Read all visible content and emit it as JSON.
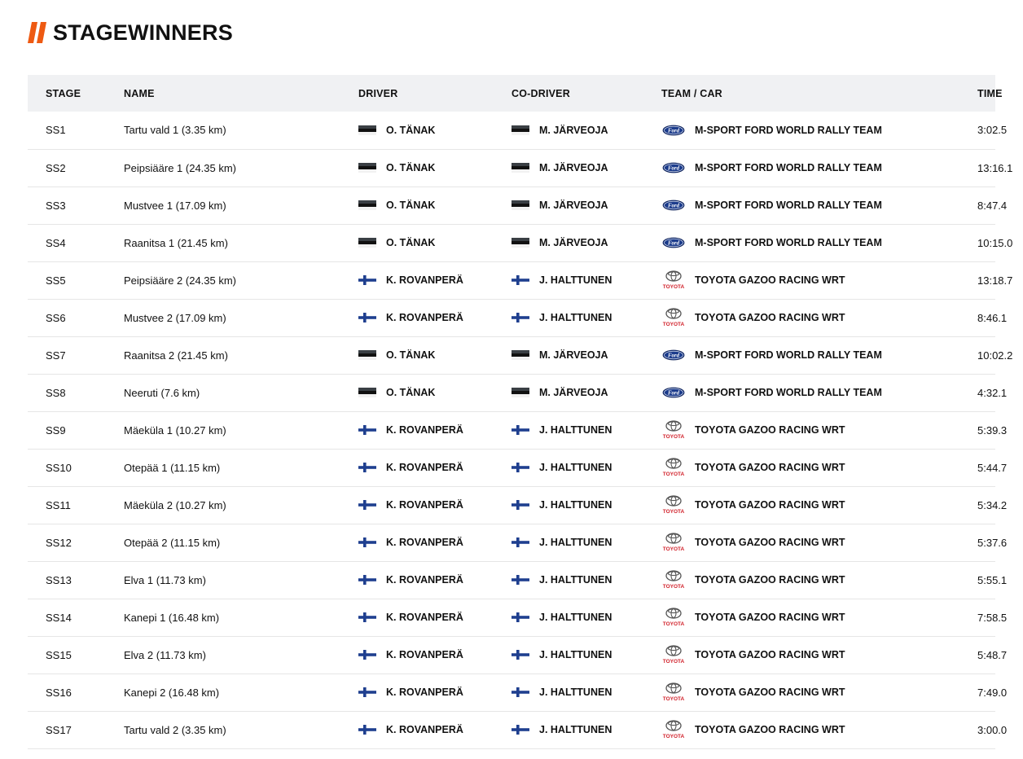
{
  "page": {
    "title": "STAGEWINNERS",
    "accent_color": "#ee5a12"
  },
  "table": {
    "headers": {
      "stage": "STAGE",
      "name": "NAME",
      "driver": "DRIVER",
      "co_driver": "CO-DRIVER",
      "team_car": "TEAM / CAR",
      "time": "TIME"
    },
    "rows": [
      {
        "stage": "SS1",
        "name": "Tartu vald 1 (3.35 km)",
        "driver": "O. TÄNAK",
        "driver_flag": "estonia-flag-icon",
        "co_driver": "M. JÄRVEOJA",
        "co_driver_flag": "estonia-flag-icon",
        "team": "M-SPORT FORD WORLD RALLY TEAM",
        "team_logo": "ford-logo-icon",
        "time": "3:02.5"
      },
      {
        "stage": "SS2",
        "name": "Peipsiääre 1 (24.35 km)",
        "driver": "O. TÄNAK",
        "driver_flag": "estonia-flag-icon",
        "co_driver": "M. JÄRVEOJA",
        "co_driver_flag": "estonia-flag-icon",
        "team": "M-SPORT FORD WORLD RALLY TEAM",
        "team_logo": "ford-logo-icon",
        "time": "13:16.1"
      },
      {
        "stage": "SS3",
        "name": "Mustvee 1 (17.09 km)",
        "driver": "O. TÄNAK",
        "driver_flag": "estonia-flag-icon",
        "co_driver": "M. JÄRVEOJA",
        "co_driver_flag": "estonia-flag-icon",
        "team": "M-SPORT FORD WORLD RALLY TEAM",
        "team_logo": "ford-logo-icon",
        "time": "8:47.4"
      },
      {
        "stage": "SS4",
        "name": "Raanitsa 1 (21.45 km)",
        "driver": "O. TÄNAK",
        "driver_flag": "estonia-flag-icon",
        "co_driver": "M. JÄRVEOJA",
        "co_driver_flag": "estonia-flag-icon",
        "team": "M-SPORT FORD WORLD RALLY TEAM",
        "team_logo": "ford-logo-icon",
        "time": "10:15.0"
      },
      {
        "stage": "SS5",
        "name": "Peipsiääre 2 (24.35 km)",
        "driver": "K. ROVANPERÄ",
        "driver_flag": "finland-flag-icon",
        "co_driver": "J. HALTTUNEN",
        "co_driver_flag": "finland-flag-icon",
        "team": "TOYOTA GAZOO RACING WRT",
        "team_logo": "toyota-logo-icon",
        "time": "13:18.7"
      },
      {
        "stage": "SS6",
        "name": "Mustvee 2 (17.09 km)",
        "driver": "K. ROVANPERÄ",
        "driver_flag": "finland-flag-icon",
        "co_driver": "J. HALTTUNEN",
        "co_driver_flag": "finland-flag-icon",
        "team": "TOYOTA GAZOO RACING WRT",
        "team_logo": "toyota-logo-icon",
        "time": "8:46.1"
      },
      {
        "stage": "SS7",
        "name": "Raanitsa 2 (21.45 km)",
        "driver": "O. TÄNAK",
        "driver_flag": "estonia-flag-icon",
        "co_driver": "M. JÄRVEOJA",
        "co_driver_flag": "estonia-flag-icon",
        "team": "M-SPORT FORD WORLD RALLY TEAM",
        "team_logo": "ford-logo-icon",
        "time": "10:02.2"
      },
      {
        "stage": "SS8",
        "name": "Neeruti (7.6 km)",
        "driver": "O. TÄNAK",
        "driver_flag": "estonia-flag-icon",
        "co_driver": "M. JÄRVEOJA",
        "co_driver_flag": "estonia-flag-icon",
        "team": "M-SPORT FORD WORLD RALLY TEAM",
        "team_logo": "ford-logo-icon",
        "time": "4:32.1"
      },
      {
        "stage": "SS9",
        "name": "Mäeküla 1 (10.27 km)",
        "driver": "K. ROVANPERÄ",
        "driver_flag": "finland-flag-icon",
        "co_driver": "J. HALTTUNEN",
        "co_driver_flag": "finland-flag-icon",
        "team": "TOYOTA GAZOO RACING WRT",
        "team_logo": "toyota-logo-icon",
        "time": "5:39.3"
      },
      {
        "stage": "SS10",
        "name": "Otepää 1 (11.15 km)",
        "driver": "K. ROVANPERÄ",
        "driver_flag": "finland-flag-icon",
        "co_driver": "J. HALTTUNEN",
        "co_driver_flag": "finland-flag-icon",
        "team": "TOYOTA GAZOO RACING WRT",
        "team_logo": "toyota-logo-icon",
        "time": "5:44.7"
      },
      {
        "stage": "SS11",
        "name": "Mäeküla 2 (10.27 km)",
        "driver": "K. ROVANPERÄ",
        "driver_flag": "finland-flag-icon",
        "co_driver": "J. HALTTUNEN",
        "co_driver_flag": "finland-flag-icon",
        "team": "TOYOTA GAZOO RACING WRT",
        "team_logo": "toyota-logo-icon",
        "time": "5:34.2"
      },
      {
        "stage": "SS12",
        "name": "Otepää 2 (11.15 km)",
        "driver": "K. ROVANPERÄ",
        "driver_flag": "finland-flag-icon",
        "co_driver": "J. HALTTUNEN",
        "co_driver_flag": "finland-flag-icon",
        "team": "TOYOTA GAZOO RACING WRT",
        "team_logo": "toyota-logo-icon",
        "time": "5:37.6"
      },
      {
        "stage": "SS13",
        "name": "Elva 1 (11.73 km)",
        "driver": "K. ROVANPERÄ",
        "driver_flag": "finland-flag-icon",
        "co_driver": "J. HALTTUNEN",
        "co_driver_flag": "finland-flag-icon",
        "team": "TOYOTA GAZOO RACING WRT",
        "team_logo": "toyota-logo-icon",
        "time": "5:55.1"
      },
      {
        "stage": "SS14",
        "name": "Kanepi 1 (16.48 km)",
        "driver": "K. ROVANPERÄ",
        "driver_flag": "finland-flag-icon",
        "co_driver": "J. HALTTUNEN",
        "co_driver_flag": "finland-flag-icon",
        "team": "TOYOTA GAZOO RACING WRT",
        "team_logo": "toyota-logo-icon",
        "time": "7:58.5"
      },
      {
        "stage": "SS15",
        "name": "Elva 2 (11.73 km)",
        "driver": "K. ROVANPERÄ",
        "driver_flag": "finland-flag-icon",
        "co_driver": "J. HALTTUNEN",
        "co_driver_flag": "finland-flag-icon",
        "team": "TOYOTA GAZOO RACING WRT",
        "team_logo": "toyota-logo-icon",
        "time": "5:48.7"
      },
      {
        "stage": "SS16",
        "name": "Kanepi 2 (16.48 km)",
        "driver": "K. ROVANPERÄ",
        "driver_flag": "finland-flag-icon",
        "co_driver": "J. HALTTUNEN",
        "co_driver_flag": "finland-flag-icon",
        "team": "TOYOTA GAZOO RACING WRT",
        "team_logo": "toyota-logo-icon",
        "time": "7:49.0"
      },
      {
        "stage": "SS17",
        "name": "Tartu vald 2 (3.35 km)",
        "driver": "K. ROVANPERÄ",
        "driver_flag": "finland-flag-icon",
        "co_driver": "J. HALTTUNEN",
        "co_driver_flag": "finland-flag-icon",
        "team": "TOYOTA GAZOO RACING WRT",
        "team_logo": "toyota-logo-icon",
        "time": "3:00.0"
      }
    ]
  },
  "logos": {
    "toyota_wordmark": "TOYOTA",
    "ford_wordmark": "Ford"
  }
}
